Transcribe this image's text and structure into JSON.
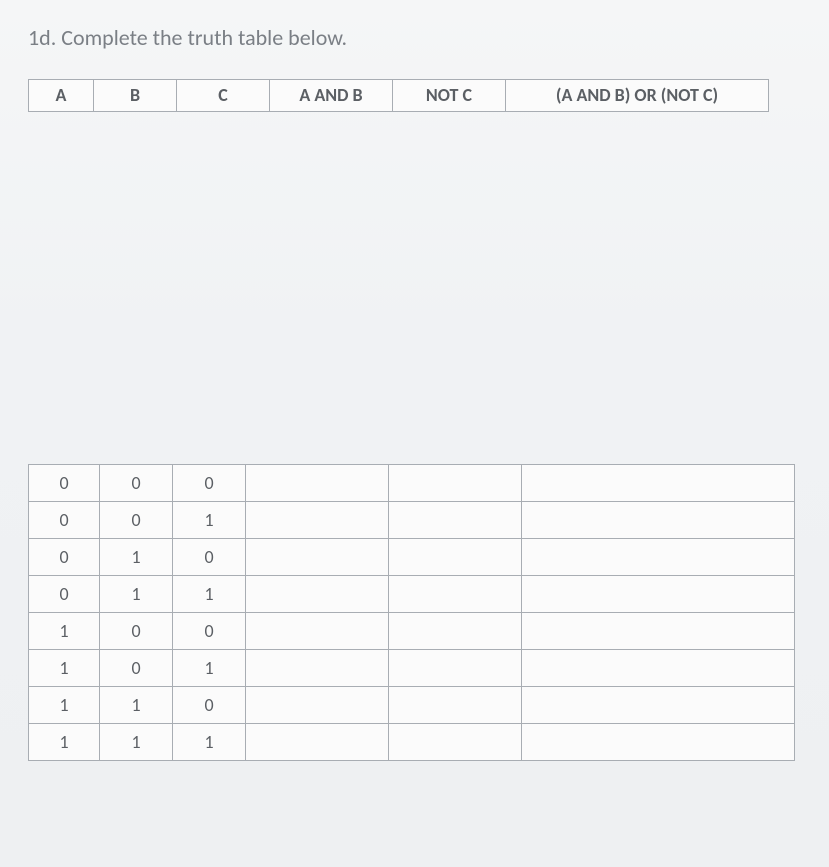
{
  "prompt": "1d. Complete the truth table below.",
  "headers": {
    "a": "A",
    "b": "B",
    "c": "C",
    "d": "A AND B",
    "e": "NOT C",
    "f": "(A AND B) OR (NOT C)"
  },
  "rows": [
    {
      "a": "0",
      "b": "0",
      "c": "0",
      "d": "",
      "e": "",
      "f": ""
    },
    {
      "a": "0",
      "b": "0",
      "c": "1",
      "d": "",
      "e": "",
      "f": ""
    },
    {
      "a": "0",
      "b": "1",
      "c": "0",
      "d": "",
      "e": "",
      "f": ""
    },
    {
      "a": "0",
      "b": "1",
      "c": "1",
      "d": "",
      "e": "",
      "f": ""
    },
    {
      "a": "1",
      "b": "0",
      "c": "0",
      "d": "",
      "e": "",
      "f": ""
    },
    {
      "a": "1",
      "b": "0",
      "c": "1",
      "d": "",
      "e": "",
      "f": ""
    },
    {
      "a": "1",
      "b": "1",
      "c": "0",
      "d": "",
      "e": "",
      "f": ""
    },
    {
      "a": "1",
      "b": "1",
      "c": "1",
      "d": "",
      "e": "",
      "f": ""
    }
  ]
}
